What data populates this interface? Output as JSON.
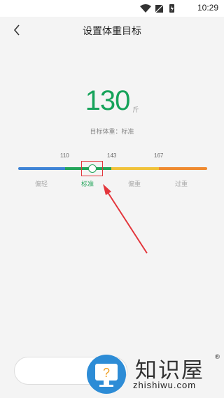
{
  "status_bar": {
    "time": "10:29"
  },
  "header": {
    "title": "设置体重目标"
  },
  "weight": {
    "value": "130",
    "unit": "斤",
    "target_label": "目标体重：标准"
  },
  "scale": {
    "ticks": [
      "110",
      "143",
      "167"
    ],
    "categories": [
      {
        "label": "偏轻",
        "color": "#3f84d6"
      },
      {
        "label": "标准",
        "color": "#23a55a"
      },
      {
        "label": "偏重",
        "color": "#f0c23a"
      },
      {
        "label": "过重",
        "color": "#ef8a30"
      }
    ],
    "active_category": "标准"
  },
  "watermark": {
    "brand": "知识屋",
    "reg": "®",
    "url": "zhishiwu.com",
    "logo_char": "?"
  },
  "colors": {
    "accent": "#16a35a",
    "highlight": "#e3353b"
  }
}
